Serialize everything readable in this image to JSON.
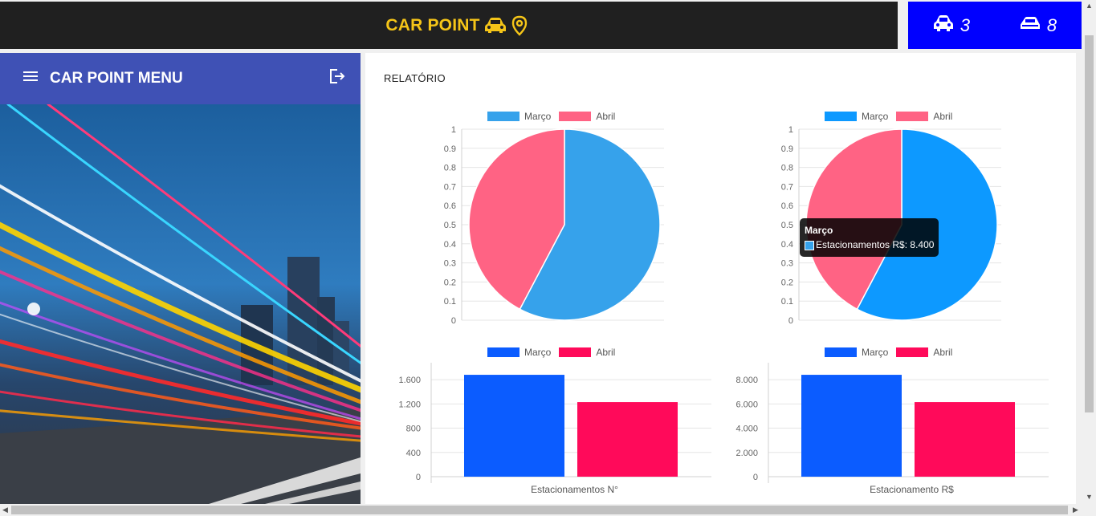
{
  "header": {
    "brand": "CAR POINT",
    "accent": "#f5c518"
  },
  "counters": [
    {
      "icon": "car-front-icon",
      "value": "3"
    },
    {
      "icon": "car-side-icon",
      "value": "8"
    }
  ],
  "sidebar": {
    "menu_label": "CAR POINT MENU",
    "menu_icon": "hamburger-icon",
    "logout_icon": "logout-icon"
  },
  "main": {
    "title": "RELATÓRIO"
  },
  "tooltip": {
    "title": "Março",
    "label": "Estacionamentos R$: 8.400"
  },
  "chart_data": [
    {
      "type": "pie",
      "categories": [
        "Março",
        "Abril"
      ],
      "values": [
        1680,
        1230
      ],
      "colors": [
        "#36a2eb",
        "#ff6384"
      ],
      "legend": "top",
      "yticks": [
        "1",
        "0.9",
        "0.8",
        "0.7",
        "0.6",
        "0.5",
        "0.4",
        "0.3",
        "0.2",
        "0.1",
        "0"
      ]
    },
    {
      "type": "pie",
      "categories": [
        "Março",
        "Abril"
      ],
      "values": [
        8400,
        6150
      ],
      "colors": [
        "#0d99ff",
        "#ff6384"
      ],
      "legend": "top",
      "yticks": [
        "1",
        "0.9",
        "0.8",
        "0.7",
        "0.6",
        "0.5",
        "0.4",
        "0.3",
        "0.2",
        "0.1",
        "0"
      ]
    },
    {
      "type": "bar",
      "xlabel": "Estacionamentos N°",
      "series": [
        {
          "name": "Março",
          "values": [
            1680
          ],
          "color": "#0b5cff"
        },
        {
          "name": "Abril",
          "values": [
            1230
          ],
          "color": "#ff0a5a"
        }
      ],
      "ylim": [
        0,
        1800
      ],
      "yticks": [
        "1.600",
        "1.200",
        "800",
        "400",
        "0"
      ],
      "ytick_values": [
        1600,
        1200,
        800,
        400,
        0
      ],
      "legend": "top"
    },
    {
      "type": "bar",
      "xlabel": "Estacionamento R$",
      "series": [
        {
          "name": "Março",
          "values": [
            8400
          ],
          "color": "#0b5cff"
        },
        {
          "name": "Abril",
          "values": [
            6150
          ],
          "color": "#ff0a5a"
        }
      ],
      "ylim": [
        0,
        9000
      ],
      "yticks": [
        "8.000",
        "6.000",
        "4.000",
        "2.000",
        "0"
      ],
      "ytick_values": [
        8000,
        6000,
        4000,
        2000,
        0
      ],
      "legend": "top"
    }
  ]
}
